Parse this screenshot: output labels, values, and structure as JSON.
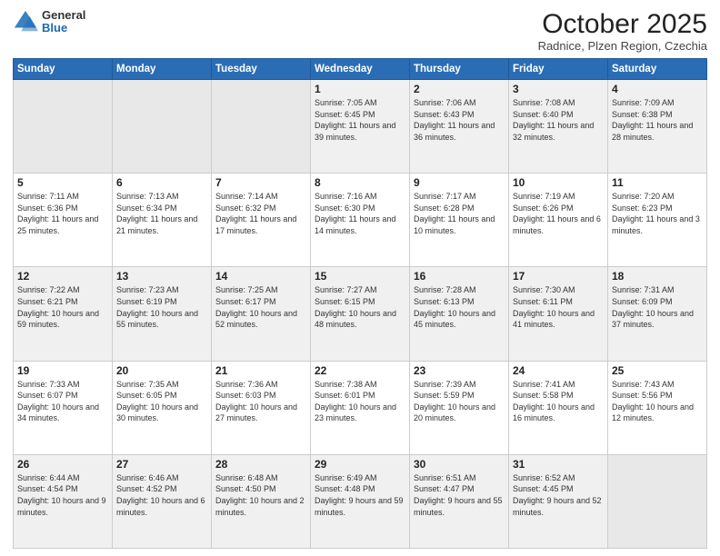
{
  "header": {
    "logo_general": "General",
    "logo_blue": "Blue",
    "month_title": "October 2025",
    "location": "Radnice, Plzen Region, Czechia"
  },
  "weekdays": [
    "Sunday",
    "Monday",
    "Tuesday",
    "Wednesday",
    "Thursday",
    "Friday",
    "Saturday"
  ],
  "weeks": [
    [
      {
        "day": "",
        "sunrise": "",
        "sunset": "",
        "daylight": "",
        "empty": true
      },
      {
        "day": "",
        "sunrise": "",
        "sunset": "",
        "daylight": "",
        "empty": true
      },
      {
        "day": "",
        "sunrise": "",
        "sunset": "",
        "daylight": "",
        "empty": true
      },
      {
        "day": "1",
        "sunrise": "Sunrise: 7:05 AM",
        "sunset": "Sunset: 6:45 PM",
        "daylight": "Daylight: 11 hours and 39 minutes.",
        "empty": false
      },
      {
        "day": "2",
        "sunrise": "Sunrise: 7:06 AM",
        "sunset": "Sunset: 6:43 PM",
        "daylight": "Daylight: 11 hours and 36 minutes.",
        "empty": false
      },
      {
        "day": "3",
        "sunrise": "Sunrise: 7:08 AM",
        "sunset": "Sunset: 6:40 PM",
        "daylight": "Daylight: 11 hours and 32 minutes.",
        "empty": false
      },
      {
        "day": "4",
        "sunrise": "Sunrise: 7:09 AM",
        "sunset": "Sunset: 6:38 PM",
        "daylight": "Daylight: 11 hours and 28 minutes.",
        "empty": false
      }
    ],
    [
      {
        "day": "5",
        "sunrise": "Sunrise: 7:11 AM",
        "sunset": "Sunset: 6:36 PM",
        "daylight": "Daylight: 11 hours and 25 minutes.",
        "empty": false
      },
      {
        "day": "6",
        "sunrise": "Sunrise: 7:13 AM",
        "sunset": "Sunset: 6:34 PM",
        "daylight": "Daylight: 11 hours and 21 minutes.",
        "empty": false
      },
      {
        "day": "7",
        "sunrise": "Sunrise: 7:14 AM",
        "sunset": "Sunset: 6:32 PM",
        "daylight": "Daylight: 11 hours and 17 minutes.",
        "empty": false
      },
      {
        "day": "8",
        "sunrise": "Sunrise: 7:16 AM",
        "sunset": "Sunset: 6:30 PM",
        "daylight": "Daylight: 11 hours and 14 minutes.",
        "empty": false
      },
      {
        "day": "9",
        "sunrise": "Sunrise: 7:17 AM",
        "sunset": "Sunset: 6:28 PM",
        "daylight": "Daylight: 11 hours and 10 minutes.",
        "empty": false
      },
      {
        "day": "10",
        "sunrise": "Sunrise: 7:19 AM",
        "sunset": "Sunset: 6:26 PM",
        "daylight": "Daylight: 11 hours and 6 minutes.",
        "empty": false
      },
      {
        "day": "11",
        "sunrise": "Sunrise: 7:20 AM",
        "sunset": "Sunset: 6:23 PM",
        "daylight": "Daylight: 11 hours and 3 minutes.",
        "empty": false
      }
    ],
    [
      {
        "day": "12",
        "sunrise": "Sunrise: 7:22 AM",
        "sunset": "Sunset: 6:21 PM",
        "daylight": "Daylight: 10 hours and 59 minutes.",
        "empty": false
      },
      {
        "day": "13",
        "sunrise": "Sunrise: 7:23 AM",
        "sunset": "Sunset: 6:19 PM",
        "daylight": "Daylight: 10 hours and 55 minutes.",
        "empty": false
      },
      {
        "day": "14",
        "sunrise": "Sunrise: 7:25 AM",
        "sunset": "Sunset: 6:17 PM",
        "daylight": "Daylight: 10 hours and 52 minutes.",
        "empty": false
      },
      {
        "day": "15",
        "sunrise": "Sunrise: 7:27 AM",
        "sunset": "Sunset: 6:15 PM",
        "daylight": "Daylight: 10 hours and 48 minutes.",
        "empty": false
      },
      {
        "day": "16",
        "sunrise": "Sunrise: 7:28 AM",
        "sunset": "Sunset: 6:13 PM",
        "daylight": "Daylight: 10 hours and 45 minutes.",
        "empty": false
      },
      {
        "day": "17",
        "sunrise": "Sunrise: 7:30 AM",
        "sunset": "Sunset: 6:11 PM",
        "daylight": "Daylight: 10 hours and 41 minutes.",
        "empty": false
      },
      {
        "day": "18",
        "sunrise": "Sunrise: 7:31 AM",
        "sunset": "Sunset: 6:09 PM",
        "daylight": "Daylight: 10 hours and 37 minutes.",
        "empty": false
      }
    ],
    [
      {
        "day": "19",
        "sunrise": "Sunrise: 7:33 AM",
        "sunset": "Sunset: 6:07 PM",
        "daylight": "Daylight: 10 hours and 34 minutes.",
        "empty": false
      },
      {
        "day": "20",
        "sunrise": "Sunrise: 7:35 AM",
        "sunset": "Sunset: 6:05 PM",
        "daylight": "Daylight: 10 hours and 30 minutes.",
        "empty": false
      },
      {
        "day": "21",
        "sunrise": "Sunrise: 7:36 AM",
        "sunset": "Sunset: 6:03 PM",
        "daylight": "Daylight: 10 hours and 27 minutes.",
        "empty": false
      },
      {
        "day": "22",
        "sunrise": "Sunrise: 7:38 AM",
        "sunset": "Sunset: 6:01 PM",
        "daylight": "Daylight: 10 hours and 23 minutes.",
        "empty": false
      },
      {
        "day": "23",
        "sunrise": "Sunrise: 7:39 AM",
        "sunset": "Sunset: 5:59 PM",
        "daylight": "Daylight: 10 hours and 20 minutes.",
        "empty": false
      },
      {
        "day": "24",
        "sunrise": "Sunrise: 7:41 AM",
        "sunset": "Sunset: 5:58 PM",
        "daylight": "Daylight: 10 hours and 16 minutes.",
        "empty": false
      },
      {
        "day": "25",
        "sunrise": "Sunrise: 7:43 AM",
        "sunset": "Sunset: 5:56 PM",
        "daylight": "Daylight: 10 hours and 12 minutes.",
        "empty": false
      }
    ],
    [
      {
        "day": "26",
        "sunrise": "Sunrise: 6:44 AM",
        "sunset": "Sunset: 4:54 PM",
        "daylight": "Daylight: 10 hours and 9 minutes.",
        "empty": false
      },
      {
        "day": "27",
        "sunrise": "Sunrise: 6:46 AM",
        "sunset": "Sunset: 4:52 PM",
        "daylight": "Daylight: 10 hours and 6 minutes.",
        "empty": false
      },
      {
        "day": "28",
        "sunrise": "Sunrise: 6:48 AM",
        "sunset": "Sunset: 4:50 PM",
        "daylight": "Daylight: 10 hours and 2 minutes.",
        "empty": false
      },
      {
        "day": "29",
        "sunrise": "Sunrise: 6:49 AM",
        "sunset": "Sunset: 4:48 PM",
        "daylight": "Daylight: 9 hours and 59 minutes.",
        "empty": false
      },
      {
        "day": "30",
        "sunrise": "Sunrise: 6:51 AM",
        "sunset": "Sunset: 4:47 PM",
        "daylight": "Daylight: 9 hours and 55 minutes.",
        "empty": false
      },
      {
        "day": "31",
        "sunrise": "Sunrise: 6:52 AM",
        "sunset": "Sunset: 4:45 PM",
        "daylight": "Daylight: 9 hours and 52 minutes.",
        "empty": false
      },
      {
        "day": "",
        "sunrise": "",
        "sunset": "",
        "daylight": "",
        "empty": true
      }
    ]
  ]
}
